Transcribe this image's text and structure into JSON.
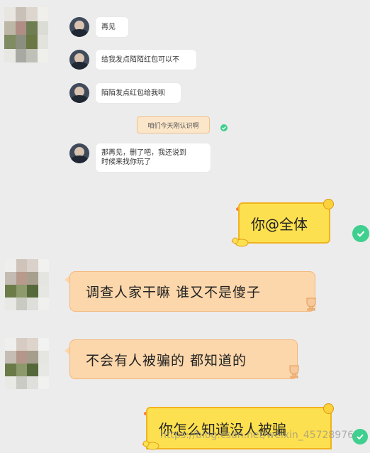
{
  "messages": {
    "m1": "再见",
    "m2": "给我发点陌陌红包可以不",
    "m3": "陌陌发点红包给我呗",
    "m4": "咱们今天刚认识啊",
    "m5_line1": "那再见，删了吧，我还说到",
    "m5_line2": "时候来找你玩了",
    "m6": "你@全体",
    "m7": "调查人家干嘛 谁又不是傻子",
    "m8": "不会有人被骗的 都知道的",
    "m9": "你怎么知道没人被骗"
  },
  "watermark": "https://blog.csdn.net/weixin_45728976",
  "icons": {
    "check": "check-circle-icon",
    "trophy": "trophy-icon",
    "coin": "coin-icon",
    "duck": "duck-icon",
    "flame": "flame-icon"
  },
  "colors": {
    "background": "#ececec",
    "bubble_orange": "#fcd7ab",
    "bubble_yellow": "#fde04f",
    "check_green": "#3fcf8e"
  }
}
